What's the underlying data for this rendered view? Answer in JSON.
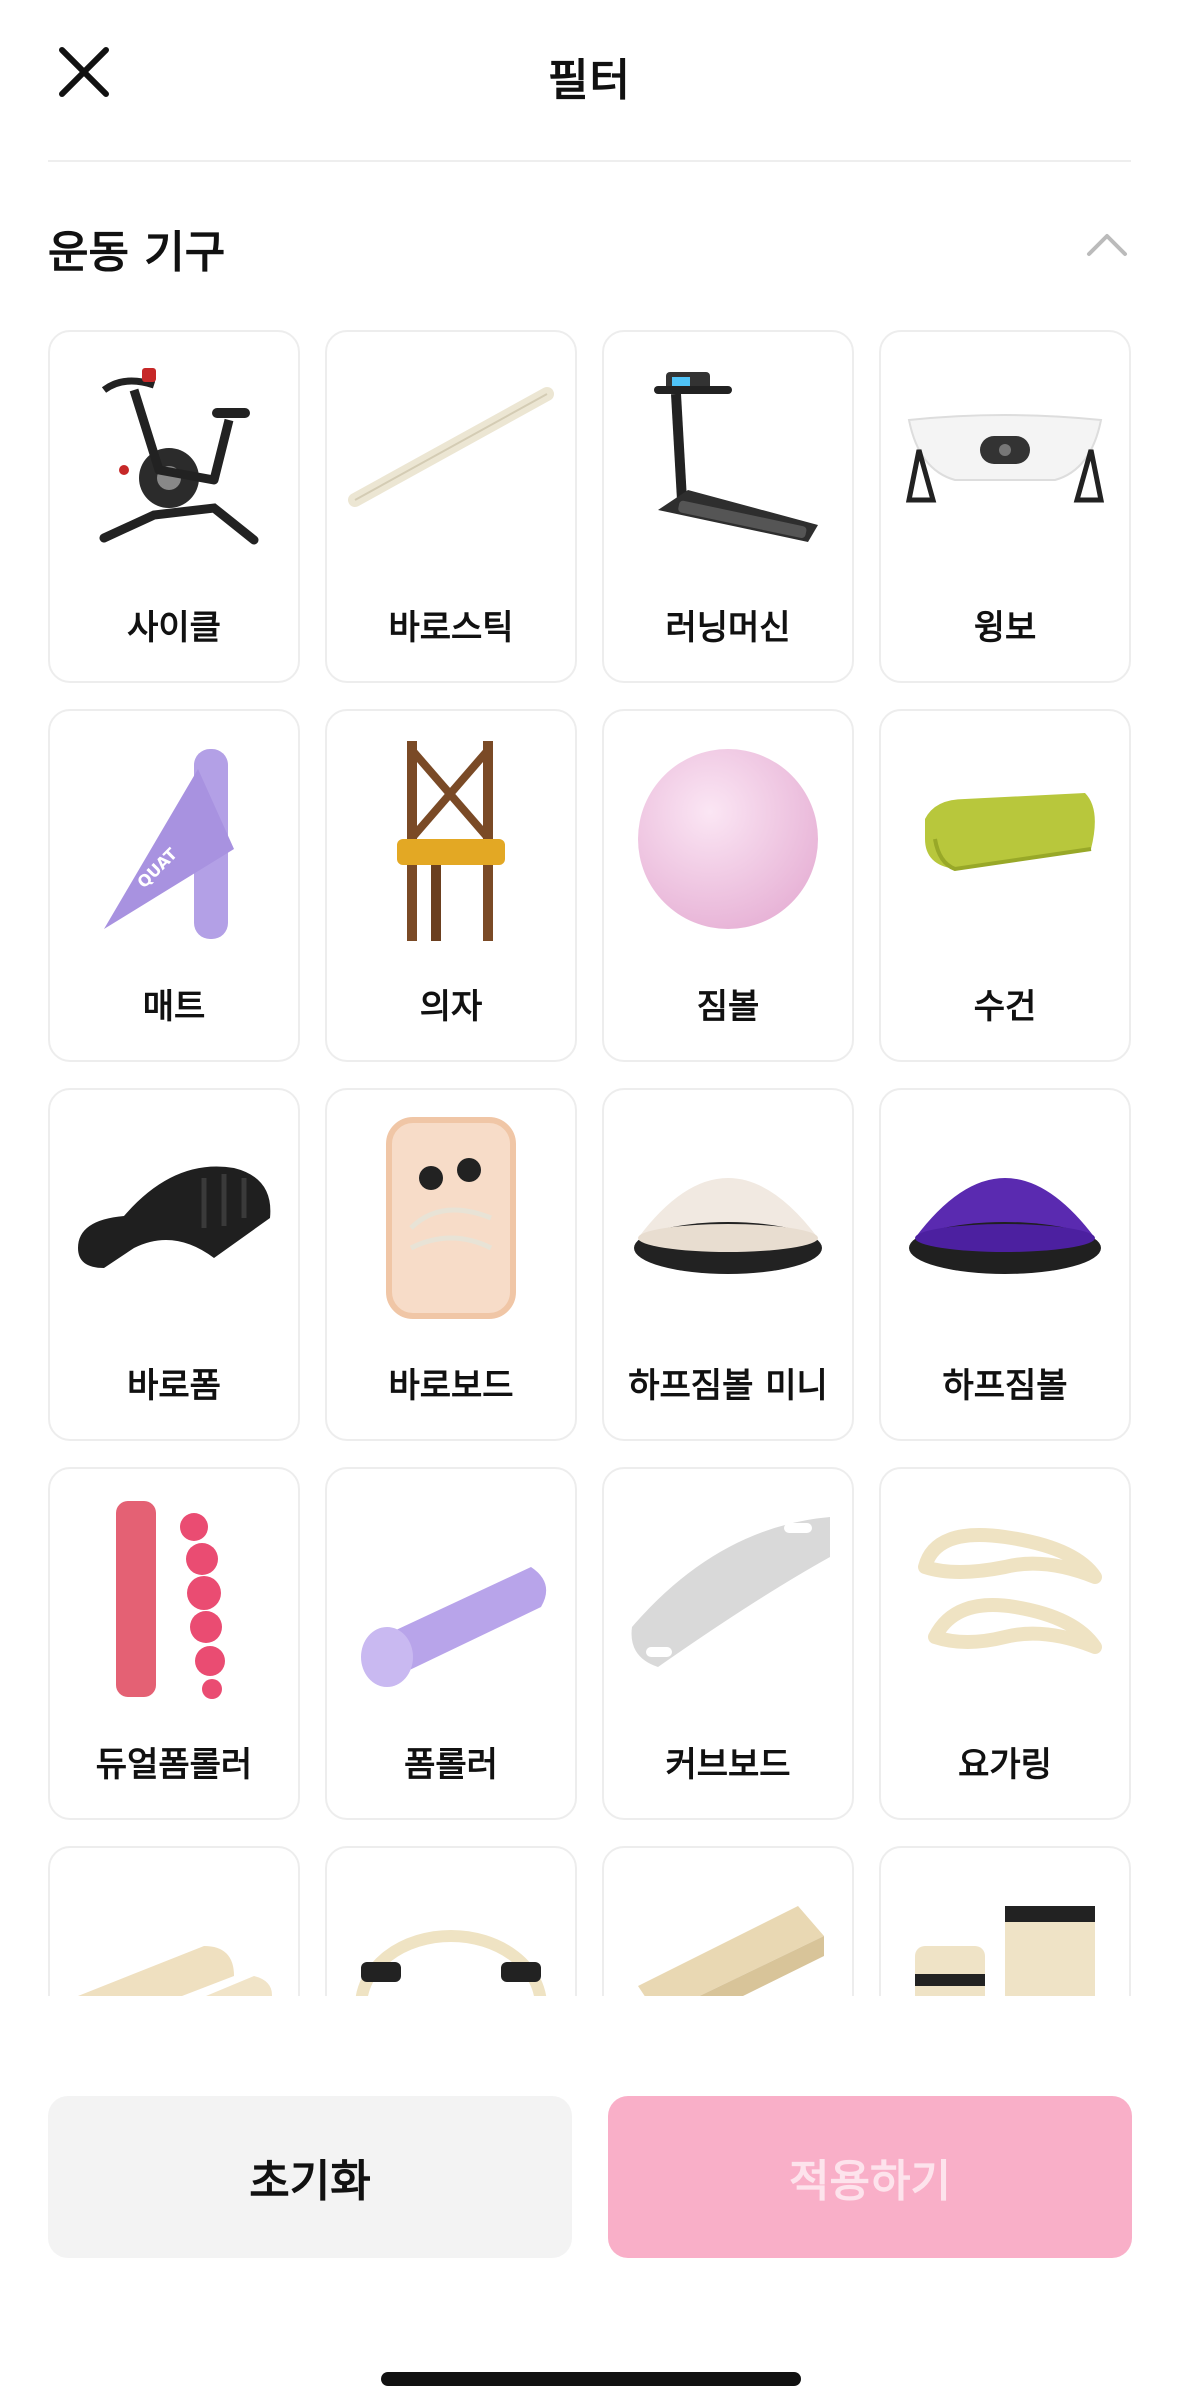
{
  "header": {
    "title": "필터",
    "close_icon": "close-icon"
  },
  "section": {
    "title": "운동 기구",
    "toggle_icon": "chevron-up-icon",
    "expanded": true
  },
  "items": [
    {
      "label": "사이클",
      "icon": "cycle-bike-image"
    },
    {
      "label": "바로스틱",
      "icon": "stick-image"
    },
    {
      "label": "러닝머신",
      "icon": "treadmill-image"
    },
    {
      "label": "윙보",
      "icon": "wingbo-image"
    },
    {
      "label": "매트",
      "icon": "mat-image"
    },
    {
      "label": "의자",
      "icon": "chair-image"
    },
    {
      "label": "짐볼",
      "icon": "gym-ball-image"
    },
    {
      "label": "수건",
      "icon": "towel-image"
    },
    {
      "label": "바로폼",
      "icon": "barofoam-image"
    },
    {
      "label": "바로보드",
      "icon": "baroboard-image"
    },
    {
      "label": "하프짐볼 미니",
      "icon": "half-gym-ball-mini-image"
    },
    {
      "label": "하프짐볼",
      "icon": "half-gym-ball-image"
    },
    {
      "label": "듀얼폼롤러",
      "icon": "dual-foam-roller-image"
    },
    {
      "label": "폼롤러",
      "icon": "foam-roller-image"
    },
    {
      "label": "커브보드",
      "icon": "curve-board-image"
    },
    {
      "label": "요가링",
      "icon": "yoga-ring-image"
    },
    {
      "label": "",
      "icon": "roller-pair-image"
    },
    {
      "label": "",
      "icon": "pilates-ring-image"
    },
    {
      "label": "",
      "icon": "wedge-board-image"
    },
    {
      "label": "",
      "icon": "weights-image"
    }
  ],
  "footer": {
    "reset_label": "초기화",
    "apply_label": "적용하기"
  },
  "colors": {
    "apply_bg": "#f9afc8",
    "apply_text": "#fde3ec",
    "reset_bg": "#f3f3f3",
    "tile_border": "#ededed"
  }
}
